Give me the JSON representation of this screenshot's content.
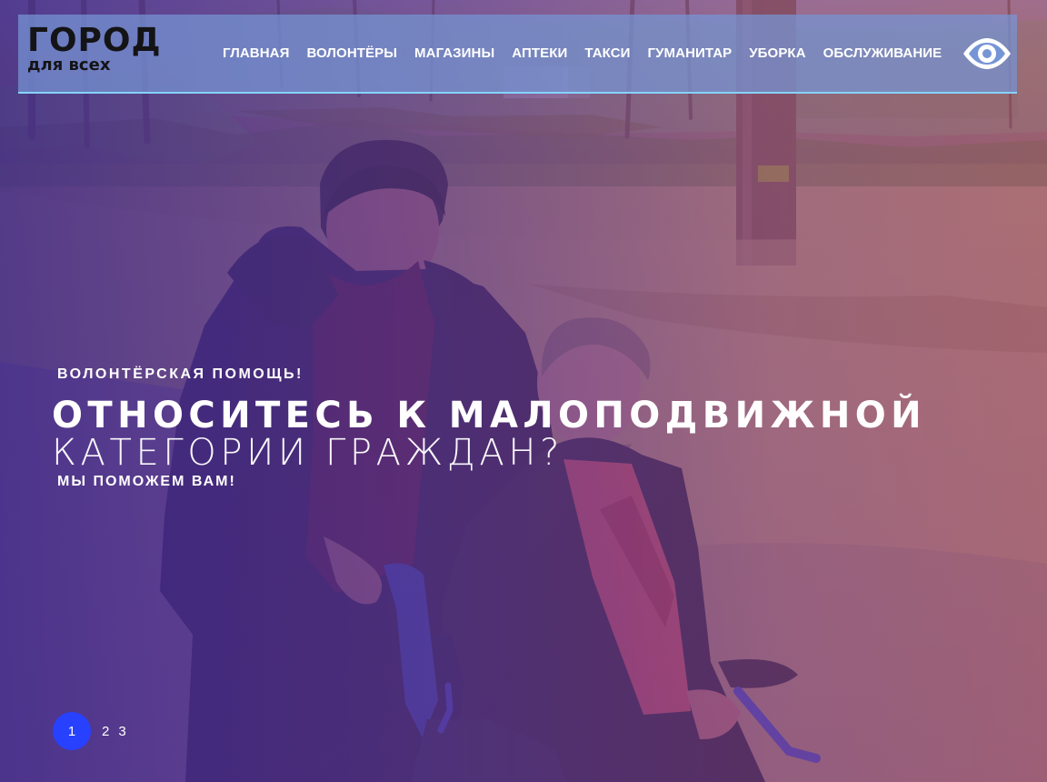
{
  "header": {
    "logo_main": "ГОРОД",
    "logo_sub": "для всех",
    "nav": [
      {
        "label": "ГЛАВНАЯ"
      },
      {
        "label": "ВОЛОНТЁРЫ"
      },
      {
        "label": "МАГАЗИНЫ"
      },
      {
        "label": "АПТЕКИ"
      },
      {
        "label": "ТАКСИ"
      },
      {
        "label": "ГУМАНИТАР"
      },
      {
        "label": "УБОРКА"
      },
      {
        "label": "ОБСЛУЖИВАНИЕ"
      }
    ],
    "accessibility_icon": "eye-icon"
  },
  "hero": {
    "eyebrow": "ВОЛОНТЁРСКАЯ ПОМОЩЬ!",
    "headline_line1": "ОТНОСИТЕСЬ К МАЛОПОДВИЖНОЙ",
    "headline_line2": "КАТЕГОРИИ ГРАЖДАН?",
    "subline": "МЫ ПОМОЖЕМ ВАМ!"
  },
  "pager": {
    "pages": [
      "1",
      "2",
      "3"
    ],
    "active_page": "1"
  },
  "colors": {
    "accent": "#2741ff",
    "nav_bar": "#7695d6",
    "nav_border": "#86d3ff",
    "overlay_left": "#3e298c",
    "overlay_right": "#bf5761"
  }
}
